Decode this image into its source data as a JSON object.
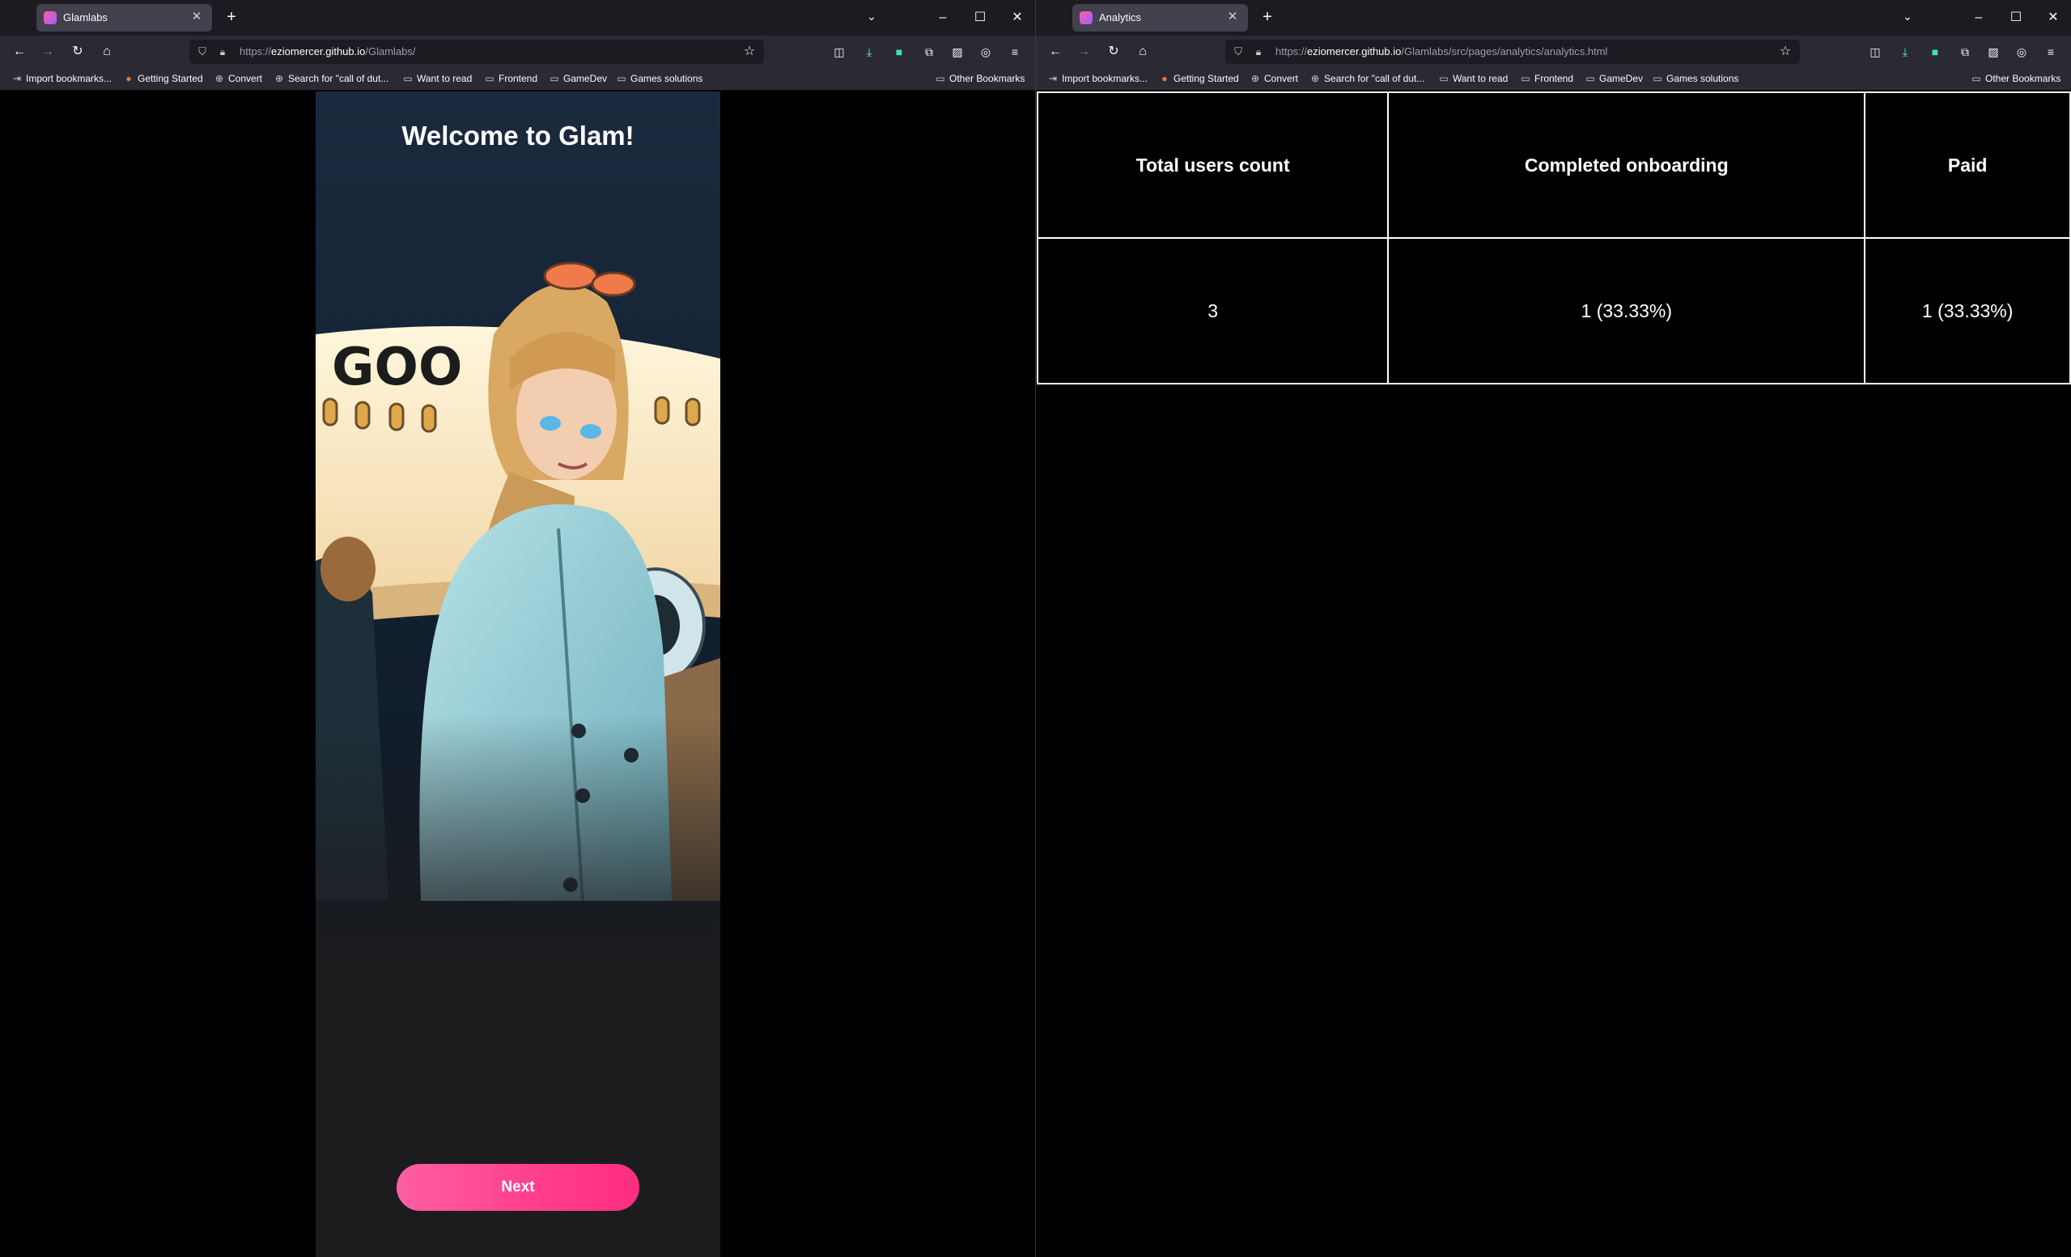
{
  "left_window": {
    "tab": {
      "title": "Glamlabs"
    },
    "url": {
      "prefix": "https://",
      "host": "eziomercer.github.io",
      "path": "/Glamlabs/"
    },
    "bookmarks": [
      "Import bookmarks...",
      "Getting Started",
      "Convert",
      "Search for \"call of dut...",
      "Want to read",
      "Frontend",
      "GameDev",
      "Games solutions"
    ],
    "other_bookmarks": "Other Bookmarks",
    "page": {
      "title": "Welcome to Glam!",
      "next_label": "Next"
    }
  },
  "right_window": {
    "tab": {
      "title": "Analytics"
    },
    "url": {
      "prefix": "https://",
      "host": "eziomercer.github.io",
      "path": "/Glamlabs/src/pages/analytics/analytics.html"
    },
    "bookmarks": [
      "Import bookmarks...",
      "Getting Started",
      "Convert",
      "Search for \"call of dut...",
      "Want to read",
      "Frontend",
      "GameDev",
      "Games solutions"
    ],
    "other_bookmarks": "Other Bookmarks",
    "table": {
      "headers": [
        "Total users count",
        "Completed onboarding",
        "Paid"
      ],
      "rows": [
        [
          "3",
          "1 (33.33%)",
          "1 (33.33%)"
        ]
      ]
    }
  },
  "colors": {
    "tab_active": "#42414d",
    "toolbar": "#2b2a33",
    "tabstrip": "#1c1b22",
    "next_button": "#ff3d8b"
  },
  "icons": [
    "close-icon",
    "plus-icon",
    "chevron-down-icon",
    "minimize-icon",
    "maximize-icon",
    "back-arrow-icon",
    "forward-arrow-icon",
    "reload-icon",
    "home-icon",
    "shield-icon",
    "lock-icon",
    "star-icon",
    "pocket-icon",
    "download-icon",
    "extensions-icon",
    "menu-icon",
    "folder-icon",
    "globe-icon"
  ]
}
